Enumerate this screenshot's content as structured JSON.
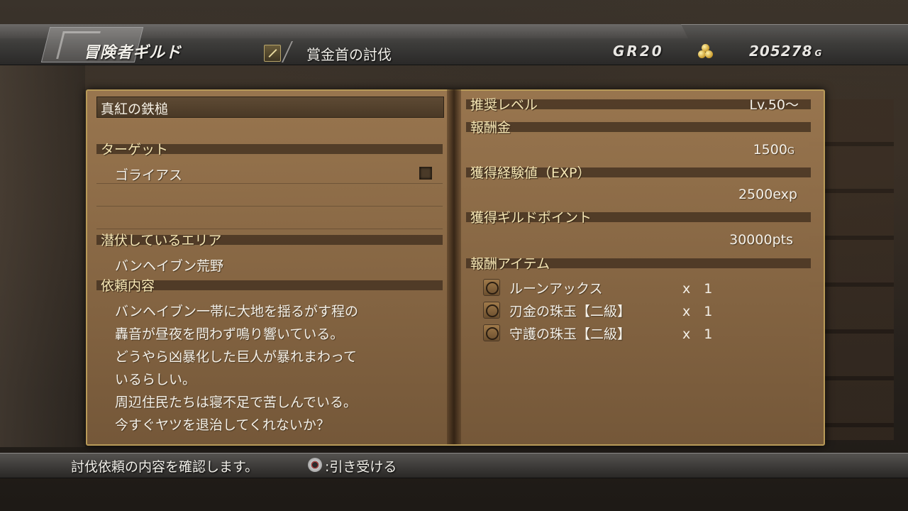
{
  "header": {
    "guild_title": "冒険者ギルド",
    "quest_type": "賞金首の討伐",
    "guild_rank": "GR20",
    "money": "205278",
    "money_unit": "G"
  },
  "quest": {
    "name": "真紅の鉄槌",
    "target_label": "ターゲット",
    "target": "ゴライアス",
    "area_label": "潜伏しているエリア",
    "area": "バンヘイブン荒野",
    "request_label": "依頼内容",
    "request_lines": [
      "バンヘイブン一帯に大地を揺るがす程の",
      "轟音が昼夜を問わず鳴り響いている。",
      "どうやら凶暴化した巨人が暴れまわって",
      "いるらしい。",
      "周辺住民たちは寝不足で苦しんでいる。",
      "今すぐヤツを退治してくれないか？"
    ]
  },
  "rewards": {
    "recommended_level_label": "推奨レベル",
    "recommended_level": "Lv.50～",
    "reward_money_label": "報酬金",
    "reward_money": "1500",
    "reward_money_unit": "G",
    "exp_label": "獲得経験値（EXP）",
    "exp_value": "2500",
    "exp_unit": "exp",
    "guild_points_label": "獲得ギルドポイント",
    "guild_points": "30000",
    "guild_points_unit": "pts",
    "items_label": "報酬アイテム",
    "items": [
      {
        "name": "ルーンアックス",
        "qty": "x　1",
        "icon": "axe-icon"
      },
      {
        "name": "刃金の珠玉【二級】",
        "qty": "x　1",
        "icon": "blade-gem-icon"
      },
      {
        "name": "守護の珠玉【二級】",
        "qty": "x　1",
        "icon": "guard-gem-icon"
      }
    ]
  },
  "footer": {
    "hint": "討伐依頼の内容を確認します。",
    "accept": ":引き受ける",
    "accept_button_icon": "circle-button-icon"
  }
}
